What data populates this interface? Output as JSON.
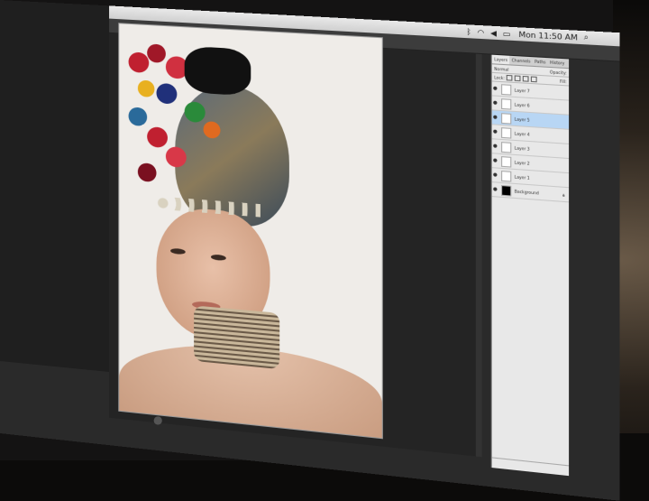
{
  "menubar": {
    "clock": "Mon 11:50 AM",
    "icons": [
      "bluetooth-icon",
      "wifi-icon",
      "volume-icon",
      "battery-icon",
      "search-icon"
    ]
  },
  "options_bar": {
    "r": "214",
    "g": "180",
    "b": "176",
    "k": "137"
  },
  "layers_panel": {
    "tabs": [
      "Layers",
      "Channels",
      "Paths",
      "History"
    ],
    "blend_mode": "Normal",
    "opacity_label": "Opacity:",
    "lock_label": "Lock:",
    "fill_label": "Fill:",
    "layers": [
      {
        "name": "Layer 7",
        "selected": false
      },
      {
        "name": "Layer 6",
        "selected": false
      },
      {
        "name": "Layer 5",
        "selected": true
      },
      {
        "name": "Layer 4",
        "selected": false
      },
      {
        "name": "Layer 3",
        "selected": false
      },
      {
        "name": "Layer 2",
        "selected": false
      },
      {
        "name": "Layer 1",
        "selected": false
      },
      {
        "name": "Background",
        "selected": false
      }
    ]
  }
}
